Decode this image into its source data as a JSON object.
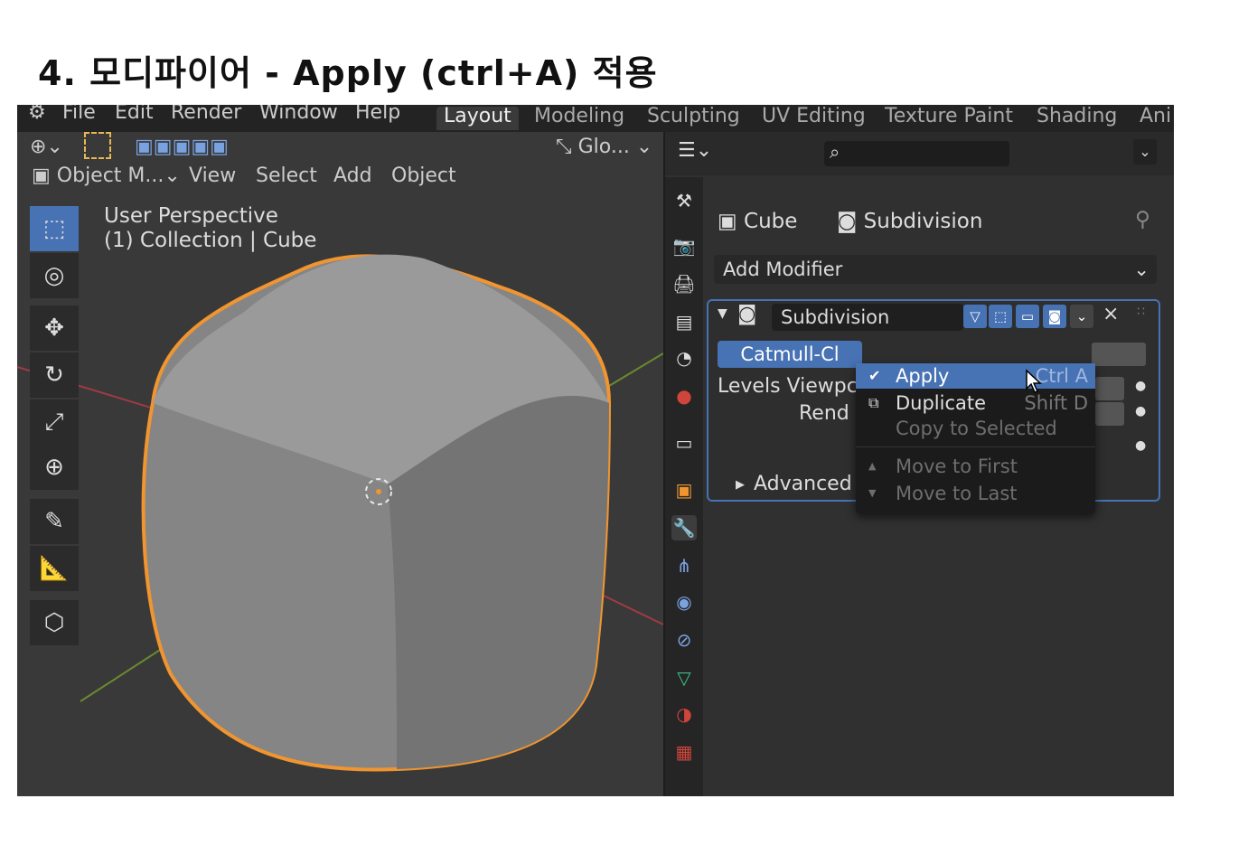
{
  "slide": {
    "title": "4. 모디파이어 - Apply (ctrl+A) 적용"
  },
  "menubar": {
    "items": [
      "File",
      "Edit",
      "Render",
      "Window",
      "Help"
    ]
  },
  "workspaces": [
    {
      "label": "Layout",
      "active": true
    },
    {
      "label": "Modeling",
      "active": false
    },
    {
      "label": "Sculpting",
      "active": false
    },
    {
      "label": "UV Editing",
      "active": false
    },
    {
      "label": "Texture Paint",
      "active": false
    },
    {
      "label": "Shading",
      "active": false
    },
    {
      "label": "Ani",
      "active": false
    }
  ],
  "viewport": {
    "transform_orientation": "Glo...",
    "mode": "Object M...",
    "menus": [
      "View",
      "Select",
      "Add",
      "Object"
    ],
    "overlay_line1": "User Perspective",
    "overlay_line2": "(1) Collection | Cube"
  },
  "properties": {
    "breadcrumb_object": "Cube",
    "breadcrumb_modifier": "Subdivision",
    "add_modifier": "Add Modifier",
    "modifier": {
      "name": "Subdivision",
      "type_tab": "Catmull-Cl",
      "levels_viewport_label": "Levels Viewpc",
      "render_label": "Rend",
      "advanced_label": "Advanced"
    },
    "context_menu": {
      "apply": {
        "label": "Apply",
        "shortcut": "Ctrl A"
      },
      "duplicate": {
        "label": "Duplicate",
        "shortcut": "Shift D"
      },
      "copy_to_selected": {
        "label": "Copy to Selected"
      },
      "move_to_first": {
        "label": "Move to First"
      },
      "move_to_last": {
        "label": "Move to Last"
      }
    }
  },
  "colors": {
    "accent": "#4772b3",
    "selection_outline": "#f0952f",
    "bg": "#303030"
  }
}
